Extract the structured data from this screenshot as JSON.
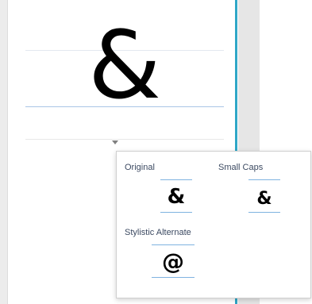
{
  "preview": {
    "glyph": "&"
  },
  "popup": {
    "options": [
      {
        "label": "Original",
        "glyph": "&"
      },
      {
        "label": "Small Caps",
        "glyph": "&"
      },
      {
        "label": "Stylistic Alternate",
        "glyph": "@"
      }
    ]
  },
  "colors": {
    "guide_line": "#a9c6e6",
    "accent_line": "#2fa7c7",
    "label_text": "#3c4a62"
  },
  "icons": [
    "dropdown-arrow-icon"
  ]
}
